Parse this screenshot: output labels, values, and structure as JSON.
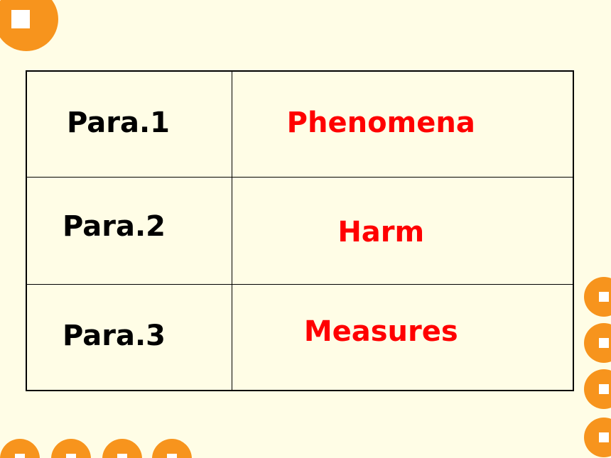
{
  "colors": {
    "background": "#FFFDE6",
    "accent_orange": "#F7941D",
    "topic_red": "#FF0000",
    "label_black": "#000000"
  },
  "rows": [
    {
      "para": "Para.1",
      "topic": "Phenomena"
    },
    {
      "para": "Para.2",
      "topic": "Harm"
    },
    {
      "para": "Para.3",
      "topic": "Measures"
    }
  ]
}
